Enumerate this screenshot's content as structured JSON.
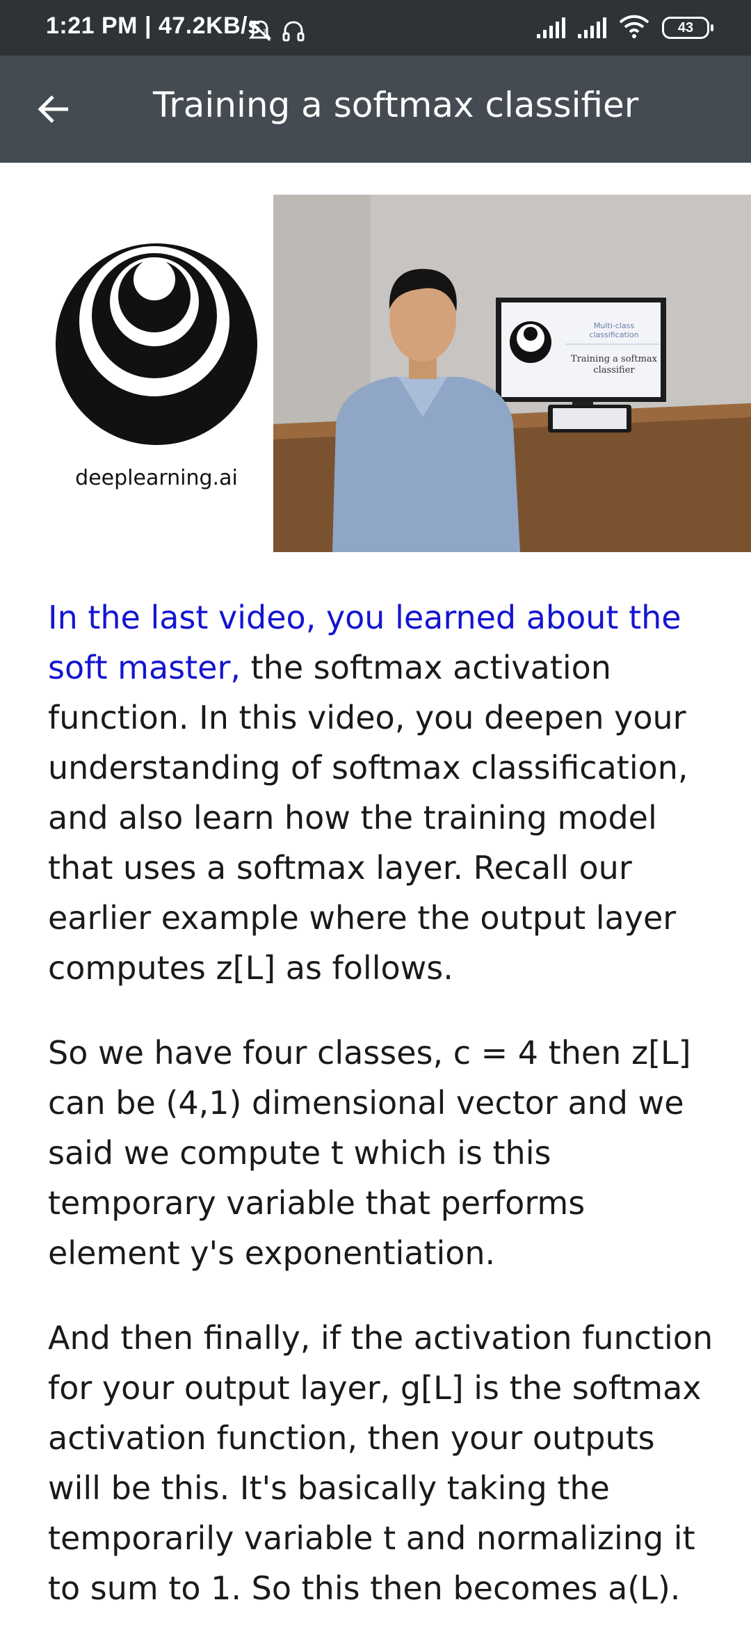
{
  "status_bar": {
    "time_speed": "1:21 PM | 47.2KB/s",
    "battery_level": "43",
    "icons": [
      "alarm-off-icon",
      "headset-icon",
      "signal-icon",
      "signal-icon",
      "wifi-icon",
      "battery-icon"
    ]
  },
  "app_bar": {
    "back_icon": "arrow-left-icon",
    "title": "Training a softmax classifier"
  },
  "header": {
    "logo_text": "deeplearning.ai",
    "video_slide_line1": "Multi-class",
    "video_slide_line2": "classification",
    "video_slide_line3": "Training a softmax",
    "video_slide_line4": "classifier"
  },
  "transcript": {
    "p1_highlight": "In the last video, you learned about the soft master,",
    "p1_rest": " the softmax activation function. In this video, you deepen your understanding of softmax classification, and also learn how the training model that uses a softmax layer. Recall our earlier example where the output layer computes z[L] as follows.",
    "p2": "So we have four classes, c = 4 then z[L] can be (4,1) dimensional vector and we said we compute t which is this temporary variable that performs element y's exponentiation.",
    "p3": "And then finally, if the activation function for your output layer, g[L] is the softmax activation function, then your outputs will be this. It's basically taking the temporarily variable t and normalizing it to sum to 1. So this then becomes a(L)."
  },
  "colors": {
    "status_bar_bg": "#2e3338",
    "app_bar_bg": "#444b52",
    "highlight_text": "#1414d2",
    "body_text": "#1a1a1a"
  }
}
